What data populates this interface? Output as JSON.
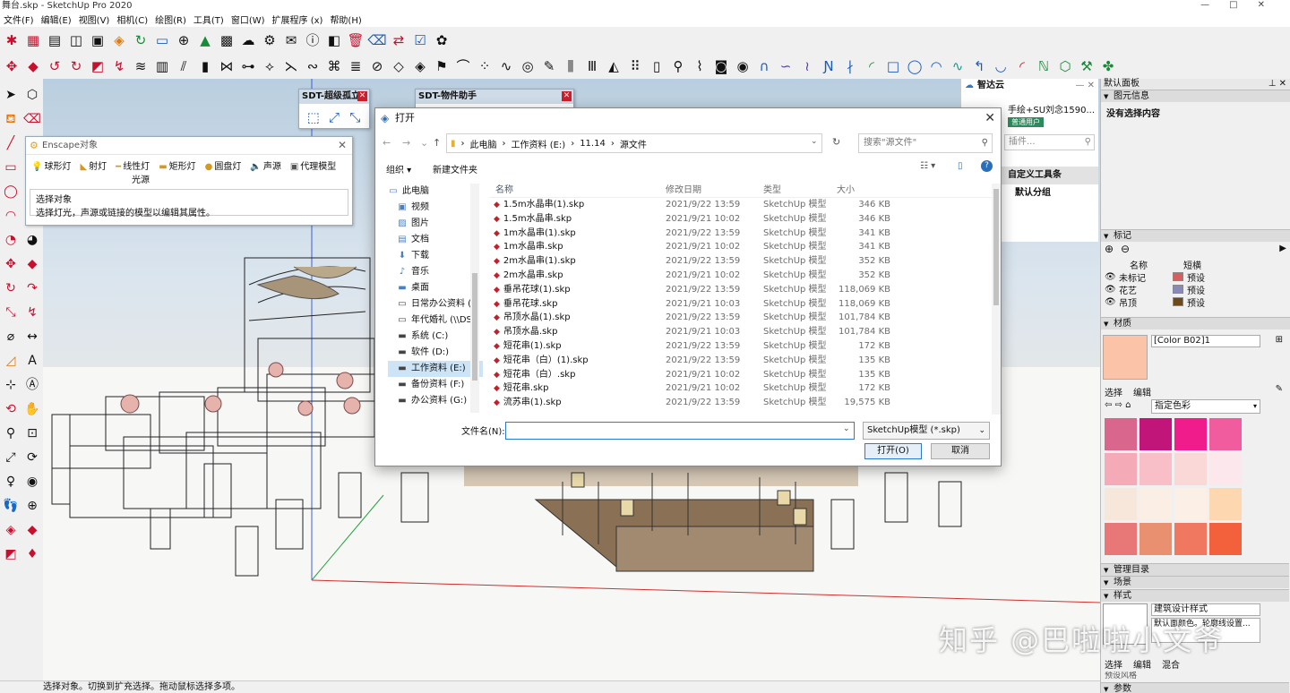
{
  "window": {
    "title": "舞台.skp - SketchUp Pro 2020"
  },
  "menu": [
    "文件(F)",
    "编辑(E)",
    "视图(V)",
    "相机(C)",
    "绘图(R)",
    "工具(T)",
    "窗口(W)",
    "扩展程序 (x)",
    "帮助(H)"
  ],
  "floating": {
    "sdt1_title": "SDT-超级孤立",
    "sdt2_title": "SDT-物件助手"
  },
  "enscape": {
    "title": "Enscape对象",
    "tools": [
      "球形灯",
      "射灯",
      "线性灯",
      "矩形灯",
      "圆盘灯",
      "声源",
      "代理模型"
    ],
    "sub": "光源",
    "hint_title": "选择对象",
    "hint_text": "选择灯光，声源或链接的模型以编辑其属性。"
  },
  "dialog": {
    "title": "打开",
    "breadcrumb": [
      "此电脑",
      "工作资料 (E:)",
      "11.14",
      "源文件"
    ],
    "search_placeholder": "搜索\"源文件\"",
    "organize": "组织 ▾",
    "new_folder": "新建文件夹",
    "nav": [
      {
        "label": "此电脑",
        "icon": "pc"
      },
      {
        "label": "视频",
        "icon": "video"
      },
      {
        "label": "图片",
        "icon": "picture"
      },
      {
        "label": "文档",
        "icon": "doc"
      },
      {
        "label": "下载",
        "icon": "download"
      },
      {
        "label": "音乐",
        "icon": "music"
      },
      {
        "label": "桌面",
        "icon": "desktop"
      },
      {
        "label": "日常办公资料 (\\",
        "icon": "drive"
      },
      {
        "label": "年代婚礼 (\\\\DS",
        "icon": "drive"
      },
      {
        "label": "系统 (C:)",
        "icon": "drive"
      },
      {
        "label": "软件 (D:)",
        "icon": "drive"
      },
      {
        "label": "工作资料 (E:)",
        "icon": "drive"
      },
      {
        "label": "备份资料 (F:)",
        "icon": "drive"
      },
      {
        "label": "办公资料 (G:)",
        "icon": "drive"
      }
    ],
    "columns": [
      "名称",
      "修改日期",
      "类型",
      "大小"
    ],
    "files": [
      [
        "1.5m水晶串(1).skp",
        "2021/9/22 13:59",
        "SketchUp 模型",
        "346 KB"
      ],
      [
        "1.5m水晶串.skp",
        "2021/9/21 10:02",
        "SketchUp 模型",
        "346 KB"
      ],
      [
        "1m水晶串(1).skp",
        "2021/9/22 13:59",
        "SketchUp 模型",
        "341 KB"
      ],
      [
        "1m水晶串.skp",
        "2021/9/21 10:02",
        "SketchUp 模型",
        "341 KB"
      ],
      [
        "2m水晶串(1).skp",
        "2021/9/22 13:59",
        "SketchUp 模型",
        "352 KB"
      ],
      [
        "2m水晶串.skp",
        "2021/9/21 10:02",
        "SketchUp 模型",
        "352 KB"
      ],
      [
        "垂吊花球(1).skp",
        "2021/9/22 13:59",
        "SketchUp 模型",
        "118,069 KB"
      ],
      [
        "垂吊花球.skp",
        "2021/9/21 10:03",
        "SketchUp 模型",
        "118,069 KB"
      ],
      [
        "吊顶水晶(1).skp",
        "2021/9/22 13:59",
        "SketchUp 模型",
        "101,784 KB"
      ],
      [
        "吊顶水晶.skp",
        "2021/9/21 10:03",
        "SketchUp 模型",
        "101,784 KB"
      ],
      [
        "短花串(1).skp",
        "2021/9/22 13:59",
        "SketchUp 模型",
        "172 KB"
      ],
      [
        "短花串（白）(1).skp",
        "2021/9/22 13:59",
        "SketchUp 模型",
        "135 KB"
      ],
      [
        "短花串（白）.skp",
        "2021/9/21 10:02",
        "SketchUp 模型",
        "135 KB"
      ],
      [
        "短花串.skp",
        "2021/9/21 10:02",
        "SketchUp 模型",
        "172 KB"
      ],
      [
        "流苏串(1).skp",
        "2021/9/22 13:59",
        "SketchUp 模型",
        "19,575 KB"
      ]
    ],
    "filename_label": "文件名(N):",
    "filename_value": "",
    "filetype": "SketchUp模型 (*.skp)",
    "open_btn": "打开(O)",
    "cancel_btn": "取消"
  },
  "zhidayun": {
    "title": "智达云",
    "user": "手绘+SU刘念1590...",
    "badge": "普通用户",
    "plugin_placeholder": "插件...",
    "custom_toolbar": "自定义工具条",
    "default_group": "默认分组"
  },
  "rightpanel": {
    "title": "默认面板",
    "entity_info": "图元信息",
    "no_selection": "没有选择内容",
    "tags": "标记",
    "tag_cols": [
      "名称",
      "短横"
    ],
    "tag_rows": [
      {
        "name": "未标记",
        "color": "#d46060",
        "dash": "预设"
      },
      {
        "name": "花艺",
        "color": "#8a8ab8",
        "dash": "预设"
      },
      {
        "name": "吊顶",
        "color": "#6e4a1a",
        "dash": "预设"
      }
    ],
    "materials": "材质",
    "material_name": "[Color B02]1",
    "tab_select": "选择",
    "tab_edit": "编辑",
    "palette": "指定色彩",
    "swatches": [
      "#d9668c",
      "#c2157a",
      "#f01c8c",
      "#f15c9e",
      "#f5aab8",
      "#f8bfc8",
      "#fad8d8",
      "#fce8ec",
      "#f7e6da",
      "#fbeee4",
      "#fcf0e6",
      "#fcd7b0",
      "#e87878",
      "#e99070",
      "#f07860",
      "#f2603c"
    ],
    "manage": "管理目录",
    "scenes": "场景",
    "styles": "样式",
    "style_name": "建筑设计样式",
    "style_desc": "默认面颜色。轮廓线设置...",
    "tab_mix": "混合",
    "params": "参数",
    "default_style": "预设风格"
  },
  "status": {
    "text": "选择对象。切换到扩充选择。拖动鼠标选择多项。"
  },
  "watermark": "知乎 @巴啦啦小文爷"
}
